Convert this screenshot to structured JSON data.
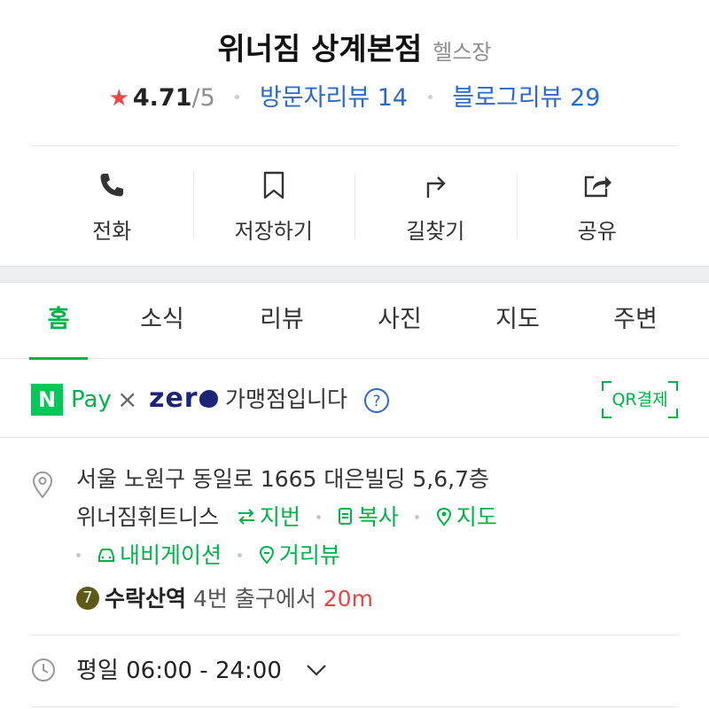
{
  "place": {
    "name": "위너짐 상계본점",
    "category": "헬스장",
    "rating": "4.71",
    "rating_max": "/5",
    "visitor_reviews": "방문자리뷰 14",
    "blog_reviews": "블로그리뷰 29"
  },
  "actions": [
    {
      "label": "전화",
      "icon": "phone-icon"
    },
    {
      "label": "저장하기",
      "icon": "bookmark-icon"
    },
    {
      "label": "길찾기",
      "icon": "directions-icon"
    },
    {
      "label": "공유",
      "icon": "share-icon"
    }
  ],
  "tabs": [
    {
      "label": "홈",
      "active": true
    },
    {
      "label": "소식",
      "active": false
    },
    {
      "label": "리뷰",
      "active": false
    },
    {
      "label": "사진",
      "active": false
    },
    {
      "label": "지도",
      "active": false
    },
    {
      "label": "주변",
      "active": false
    }
  ],
  "npay": {
    "n_letter": "N",
    "pay_label": "Pay",
    "times": "×",
    "zero_label": "zero",
    "merchant_text": "가맹점입니다",
    "help": "?",
    "qr_label": "QR결제"
  },
  "address": {
    "line1": "서울 노원구 동일로 1665 대은빌딩 5,6,7층",
    "line2": "위너짐휘트니스",
    "lot_number": "지번",
    "copy": "복사",
    "map": "지도",
    "navigation": "내비게이션",
    "street_view": "거리뷰",
    "subway_line": "7",
    "station": "수락산역",
    "exit": "4번 출구에서",
    "distance": "20m"
  },
  "hours": {
    "text": "평일 06:00 - 24:00"
  },
  "colors": {
    "accent_green": "#03b04b",
    "naver_green": "#03c75a",
    "link_blue": "#2d69c7",
    "star_red": "#f0464a",
    "distance_red": "#e64545",
    "zeropay_navy": "#1b2476",
    "subway_line7": "#5d5a17"
  }
}
